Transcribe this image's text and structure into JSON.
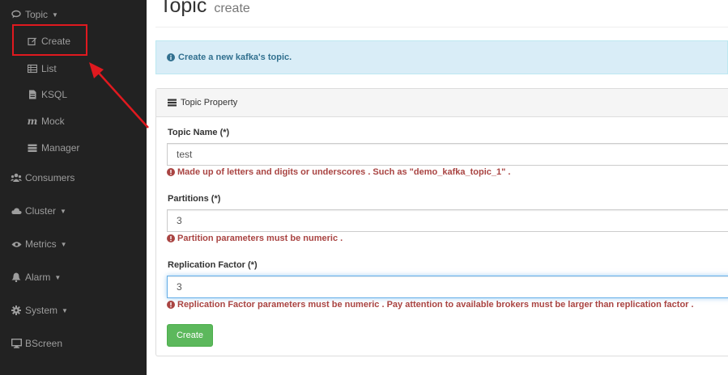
{
  "sidebar": {
    "topic": "Topic",
    "create": "Create",
    "list": "List",
    "ksql": "KSQL",
    "mock": "Mock",
    "manager": "Manager",
    "consumers": "Consumers",
    "cluster": "Cluster",
    "metrics": "Metrics",
    "alarm": "Alarm",
    "system": "System",
    "bscreen": "BScreen"
  },
  "header": {
    "title": "Topic",
    "subtitle": "create"
  },
  "alert": {
    "text": "Create a new kafka's topic."
  },
  "panel": {
    "heading": "Topic Property"
  },
  "form": {
    "topic_name_label": "Topic Name (*)",
    "topic_name_value": "test",
    "topic_name_help": "Made up of letters and digits or underscores . Such as \"demo_kafka_topic_1\" .",
    "partitions_label": "Partitions (*)",
    "partitions_value": "3",
    "partitions_help": "Partition parameters must be numeric .",
    "replication_label": "Replication Factor (*)",
    "replication_value": "3",
    "replication_help": "Replication Factor parameters must be numeric . Pay attention to available brokers must be larger than replication factor .",
    "create_button": "Create"
  },
  "colors": {
    "sidebar_bg": "#222222",
    "sidebar_text": "#9d9d9d",
    "annotation_red": "#e0191f",
    "alert_bg": "#d9edf7",
    "alert_text": "#31708f",
    "help_text": "#a94442",
    "button_green": "#5cb85c"
  },
  "icons": {
    "topic": "comment-search-icon",
    "create": "edit-icon",
    "list": "table-icon",
    "ksql": "file-icon",
    "mock": "math-m-icon",
    "manager": "tasks-icon",
    "consumers": "users-icon",
    "cluster": "cloud-icon",
    "metrics": "eye-icon",
    "alarm": "bell-icon",
    "system": "gear-icon",
    "bscreen": "desktop-icon",
    "info": "info-circle-icon",
    "panel": "tasks-icon"
  }
}
